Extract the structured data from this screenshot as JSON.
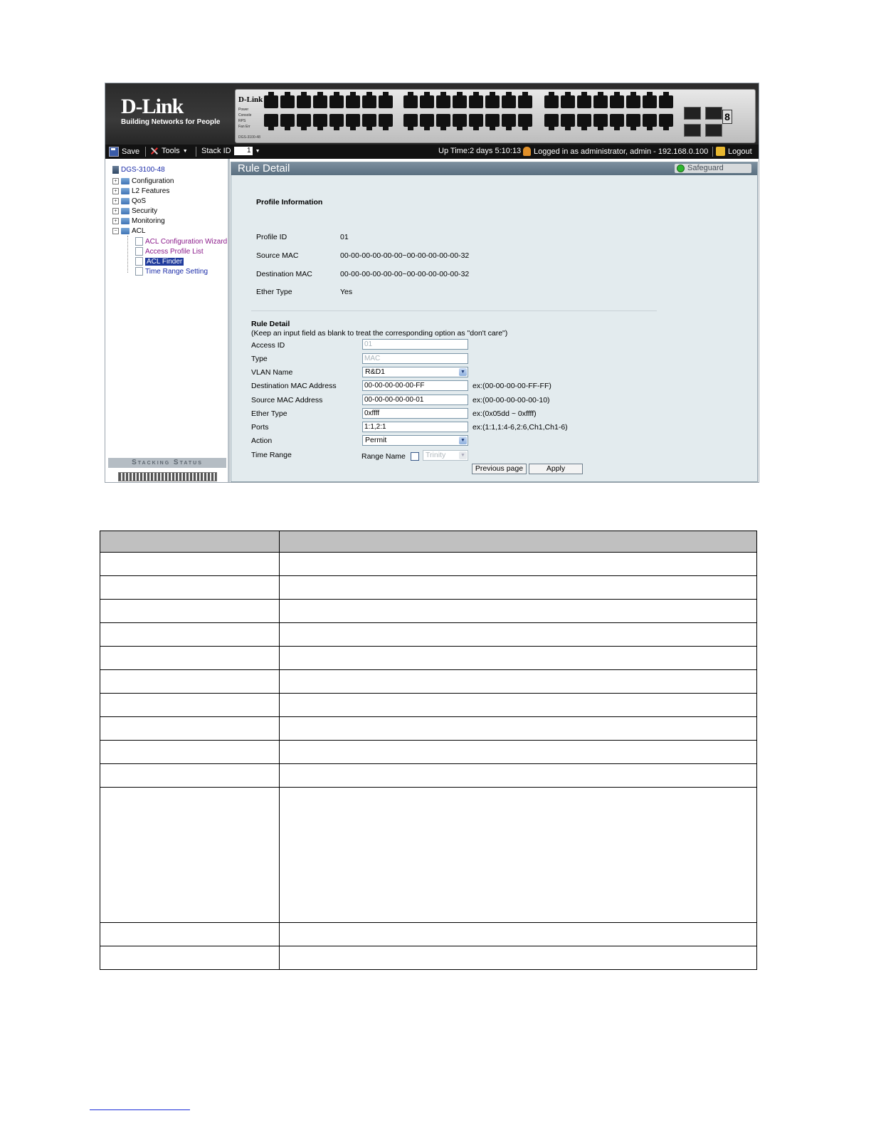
{
  "banner": {
    "brand": "D-Link",
    "tagline": "Building Networks for People",
    "panel_brand": "D-Link",
    "panel_leds": [
      "Power",
      "Console",
      "RPS",
      "Fan Err"
    ],
    "panel_model": "DGS-3100-48",
    "digit": "8"
  },
  "toolbar": {
    "save_label": "Save",
    "tools_label": "Tools",
    "stack_label": "Stack ID",
    "stack_value": "1",
    "uptime": "Up Time:2 days 5:10:13",
    "login_info": "Logged in as administrator, admin - 192.168.0.100",
    "logout_label": "Logout"
  },
  "tree": {
    "root": "DGS-3100-48",
    "folders": [
      "Configuration",
      "L2 Features",
      "QoS",
      "Security",
      "Monitoring",
      "ACL"
    ],
    "acl_items": [
      "ACL Configuration Wizard",
      "Access Profile List",
      "ACL Finder",
      "Time Range Setting"
    ],
    "selected": "ACL Finder"
  },
  "stacking": {
    "title": "Stacking Status",
    "units": 6
  },
  "content": {
    "title": "Rule Detail",
    "safeguard": "Safeguard",
    "profile_heading": "Profile Information",
    "profile": [
      {
        "label": "Profile ID",
        "value": "01"
      },
      {
        "label": "Source MAC",
        "value": "00-00-00-00-00-00~00-00-00-00-00-32"
      },
      {
        "label": "Destination MAC",
        "value": "00-00-00-00-00-00~00-00-00-00-00-32"
      },
      {
        "label": "Ether Type",
        "value": "Yes"
      }
    ],
    "rule_heading": "Rule Detail",
    "rule_note": "(Keep an input field as blank to treat the corresponding option as \"don't care\")",
    "fields": {
      "access_id": {
        "label": "Access ID",
        "value": "01"
      },
      "type": {
        "label": "Type",
        "value": "MAC"
      },
      "vlan_name": {
        "label": "VLAN Name",
        "value": "R&D1"
      },
      "dest_mac": {
        "label": "Destination MAC Address",
        "value": "00-00-00-00-00-FF",
        "hint": "ex:(00-00-00-00-FF-FF)"
      },
      "src_mac": {
        "label": "Source MAC Address",
        "value": "00-00-00-00-00-01",
        "hint": "ex:(00-00-00-00-00-10)"
      },
      "ether_type": {
        "label": "Ether Type",
        "value": "0xffff",
        "hint": "ex:(0x05dd ~ 0xffff)"
      },
      "ports": {
        "label": "Ports",
        "value": "1:1,2:1",
        "hint": "ex:(1:1,1:4-6,2:6,Ch1,Ch1-6)"
      },
      "action": {
        "label": "Action",
        "value": "Permit"
      },
      "time_range": {
        "label": "Time Range",
        "range_name_label": "Range Name",
        "range_value": "Trinity"
      }
    },
    "prev_button": "Previous page",
    "apply_button": "Apply"
  },
  "colors": {
    "title_bar": "#5a6f80",
    "content_bg": "#e3ebee",
    "selected_item": "#1f3a9c"
  }
}
